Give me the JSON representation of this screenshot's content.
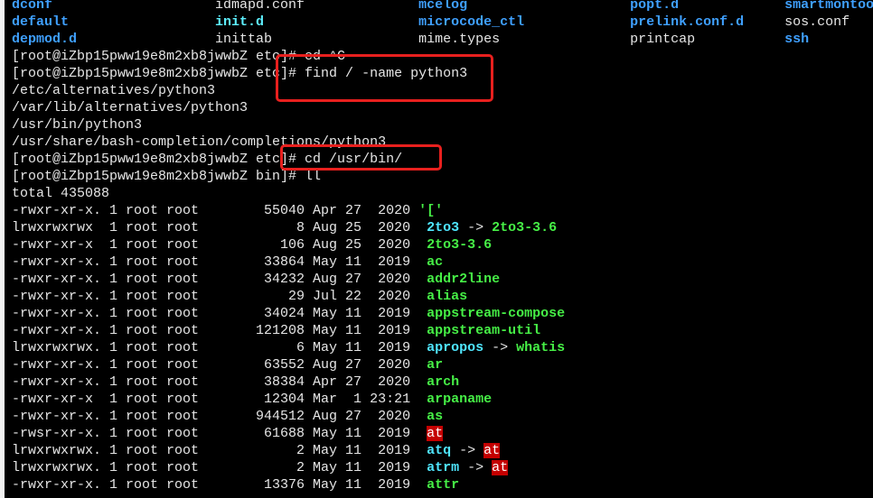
{
  "colors": {
    "dir": "#3fa0ff",
    "link": "#4fe6ff",
    "exec": "#46f046",
    "setuid_bg": "#c40000",
    "annotation": "#e8201e"
  },
  "ls_columns": [
    [
      {
        "t": "dconf",
        "c": "dir"
      },
      {
        "t": "idmapd.conf",
        "c": "plain"
      },
      {
        "t": "mcelog",
        "c": "dir"
      },
      {
        "t": "popt.d",
        "c": "dir"
      },
      {
        "t": "smartmontoo",
        "c": "dir"
      }
    ],
    [
      {
        "t": "default",
        "c": "dir"
      },
      {
        "t": "init.d",
        "c": "cyanb"
      },
      {
        "t": "microcode_ctl",
        "c": "dir"
      },
      {
        "t": "prelink.conf.d",
        "c": "dir"
      },
      {
        "t": "sos.conf",
        "c": "plain"
      }
    ],
    [
      {
        "t": "depmod.d",
        "c": "dir"
      },
      {
        "t": "inittab",
        "c": "plain"
      },
      {
        "t": "mime.types",
        "c": "plain"
      },
      {
        "t": "printcap",
        "c": "plain"
      },
      {
        "t": "ssh",
        "c": "dir"
      }
    ]
  ],
  "session": [
    "[root@iZbp15pww19e8m2xb8jwwbZ etc]# cd ^C",
    "[root@iZbp15pww19e8m2xb8jwwbZ etc]# find / -name python3",
    "/etc/alternatives/python3",
    "/var/lib/alternatives/python3",
    "/usr/bin/python3",
    "/usr/share/bash-completion/completions/python3",
    "[root@iZbp15pww19e8m2xb8jwwbZ etc]# cd /usr/bin/",
    "[root@iZbp15pww19e8m2xb8jwwbZ bin]# ll",
    "total 435088"
  ],
  "listing": [
    {
      "perm": "-rwxr-xr-x.",
      "links": "1",
      "owner": "root",
      "group": "root",
      "size": "55040",
      "month": "Apr",
      "day": "27",
      "time": "2020",
      "name": "'['",
      "cls": "exe"
    },
    {
      "perm": "lrwxrwxrwx",
      "links": "1",
      "owner": "root",
      "group": "root",
      "size": "8",
      "month": "Aug",
      "day": "25",
      "time": "2020",
      "name": "2to3",
      "cls": "link",
      "target": "2to3-3.6",
      "tcls": "exe"
    },
    {
      "perm": "-rwxr-xr-x",
      "links": "1",
      "owner": "root",
      "group": "root",
      "size": "106",
      "month": "Aug",
      "day": "25",
      "time": "2020",
      "name": "2to3-3.6",
      "cls": "exe"
    },
    {
      "perm": "-rwxr-xr-x.",
      "links": "1",
      "owner": "root",
      "group": "root",
      "size": "33864",
      "month": "May",
      "day": "11",
      "time": "2019",
      "name": "ac",
      "cls": "exe"
    },
    {
      "perm": "-rwxr-xr-x.",
      "links": "1",
      "owner": "root",
      "group": "root",
      "size": "34232",
      "month": "Aug",
      "day": "27",
      "time": "2020",
      "name": "addr2line",
      "cls": "exe"
    },
    {
      "perm": "-rwxr-xr-x.",
      "links": "1",
      "owner": "root",
      "group": "root",
      "size": "29",
      "month": "Jul",
      "day": "22",
      "time": "2020",
      "name": "alias",
      "cls": "exe"
    },
    {
      "perm": "-rwxr-xr-x.",
      "links": "1",
      "owner": "root",
      "group": "root",
      "size": "34024",
      "month": "May",
      "day": "11",
      "time": "2019",
      "name": "appstream-compose",
      "cls": "exe"
    },
    {
      "perm": "-rwxr-xr-x.",
      "links": "1",
      "owner": "root",
      "group": "root",
      "size": "121208",
      "month": "May",
      "day": "11",
      "time": "2019",
      "name": "appstream-util",
      "cls": "exe"
    },
    {
      "perm": "lrwxrwxrwx.",
      "links": "1",
      "owner": "root",
      "group": "root",
      "size": "6",
      "month": "May",
      "day": "11",
      "time": "2019",
      "name": "apropos",
      "cls": "link",
      "target": "whatis",
      "tcls": "exe"
    },
    {
      "perm": "-rwxr-xr-x.",
      "links": "1",
      "owner": "root",
      "group": "root",
      "size": "63552",
      "month": "Aug",
      "day": "27",
      "time": "2020",
      "name": "ar",
      "cls": "exe"
    },
    {
      "perm": "-rwxr-xr-x.",
      "links": "1",
      "owner": "root",
      "group": "root",
      "size": "38384",
      "month": "Apr",
      "day": "27",
      "time": "2020",
      "name": "arch",
      "cls": "exe"
    },
    {
      "perm": "-rwxr-xr-x",
      "links": "1",
      "owner": "root",
      "group": "root",
      "size": "12304",
      "month": "Mar",
      "day": "1",
      "time": "23:21",
      "name": "arpaname",
      "cls": "exe"
    },
    {
      "perm": "-rwxr-xr-x.",
      "links": "1",
      "owner": "root",
      "group": "root",
      "size": "944512",
      "month": "Aug",
      "day": "27",
      "time": "2020",
      "name": "as",
      "cls": "exe"
    },
    {
      "perm": "-rwsr-xr-x.",
      "links": "1",
      "owner": "root",
      "group": "root",
      "size": "61688",
      "month": "May",
      "day": "11",
      "time": "2019",
      "name": "at",
      "cls": "suid"
    },
    {
      "perm": "lrwxrwxrwx.",
      "links": "1",
      "owner": "root",
      "group": "root",
      "size": "2",
      "month": "May",
      "day": "11",
      "time": "2019",
      "name": "atq",
      "cls": "link",
      "target": "at",
      "tcls": "suid"
    },
    {
      "perm": "lrwxrwxrwx.",
      "links": "1",
      "owner": "root",
      "group": "root",
      "size": "2",
      "month": "May",
      "day": "11",
      "time": "2019",
      "name": "atrm",
      "cls": "link",
      "target": "at",
      "tcls": "suid"
    },
    {
      "perm": "-rwxr-xr-x.",
      "links": "1",
      "owner": "root",
      "group": "root",
      "size": "13376",
      "month": "May",
      "day": "11",
      "time": "2019",
      "name": "attr",
      "cls": "exe"
    }
  ],
  "arrow": "->"
}
